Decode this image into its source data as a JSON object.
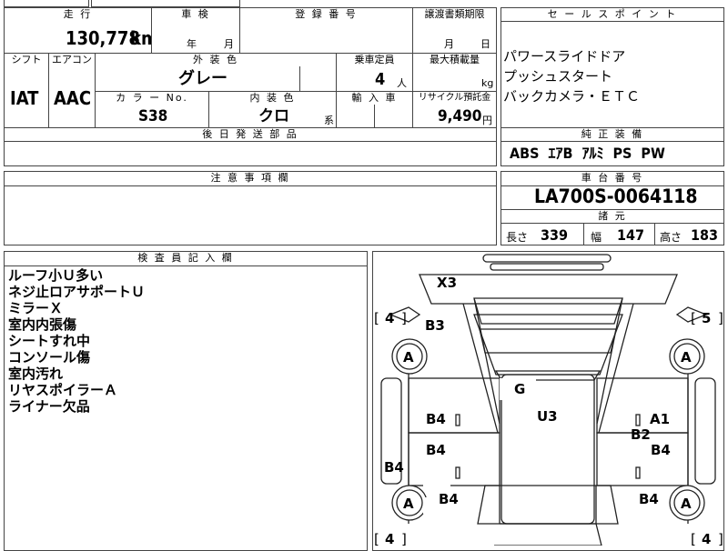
{
  "top": {
    "mileage_label": "走 行",
    "mileage_value": "130,778",
    "mileage_unit": "km",
    "inspection_label": "車 検",
    "inspection_year": "年",
    "inspection_month": "月",
    "registration_label": "登 録 番 号",
    "transfer_label": "譲渡書類期限",
    "transfer_month": "月",
    "transfer_day": "日"
  },
  "row2": {
    "shift_label": "シフト",
    "shift_value": "IAT",
    "ac_label": "エアコン",
    "ac_value": "AAC",
    "exterior_label": "外 装 色",
    "exterior_value": "グレー",
    "capacity_label": "乗車定員",
    "capacity_value": "4",
    "capacity_unit": "人",
    "maxload_label": "最大積載量",
    "maxload_unit": "kg",
    "colorno_label": "カ ラ ー No.",
    "colorno_value": "S38",
    "interior_label": "内 装 色",
    "interior_value": "クロ",
    "interior_suffix": "系",
    "import_label": "輸 入 車",
    "recycle_label": "リサイクル預託金",
    "recycle_value": "9,490",
    "recycle_unit": "円",
    "later_parts_label": "後 日 発 送 部 品"
  },
  "sales": {
    "label": "セ ー ル ス ポ イ ン ト",
    "lines": [
      "パワースライドドア",
      "プッシュスタート",
      "バックカメラ・ＥＴＣ"
    ]
  },
  "equipment": {
    "label": "純 正 装 備",
    "items": "ABS  ｴｱB  ｱﾙﾐ  PS  PW"
  },
  "caution": {
    "label": "注 意 事 項 欄"
  },
  "chassis": {
    "label": "車 台 番 号",
    "value": "LA700S-0064118",
    "spec_label": "諸 元",
    "length_label": "長さ",
    "length_value": "339",
    "width_label": "幅",
    "width_value": "147",
    "height_label": "高さ",
    "height_value": "183"
  },
  "inspector": {
    "label": "検 査 員 記 入 欄",
    "notes": [
      "ルーフ小Ｕ多い",
      "ネジ止ロアサポートＵ",
      "ミラーＸ",
      "室内内張傷",
      "シートすれ中",
      "コンソール傷",
      "室内汚れ",
      "リヤスポイラーＡ",
      "ライナー欠品"
    ]
  },
  "diagram": {
    "x3": "X3",
    "b3": "B3",
    "tire_fl": "A",
    "tire_fr": "A",
    "tire_rl": "A",
    "tire_rr": "A",
    "tread_fl": "4",
    "tread_fr": "5",
    "tread_rl": "4",
    "tread_rr": "4",
    "g": "G",
    "u3": "U3",
    "b4_left_front": "B4",
    "b4_left_mid": "B4",
    "b4_left_rocker": "B4",
    "b4_left_rear": "B4",
    "a1_right": "A1",
    "b2_right": "B2",
    "b4_right_mid": "B4",
    "b4_right_rear": "B4"
  }
}
